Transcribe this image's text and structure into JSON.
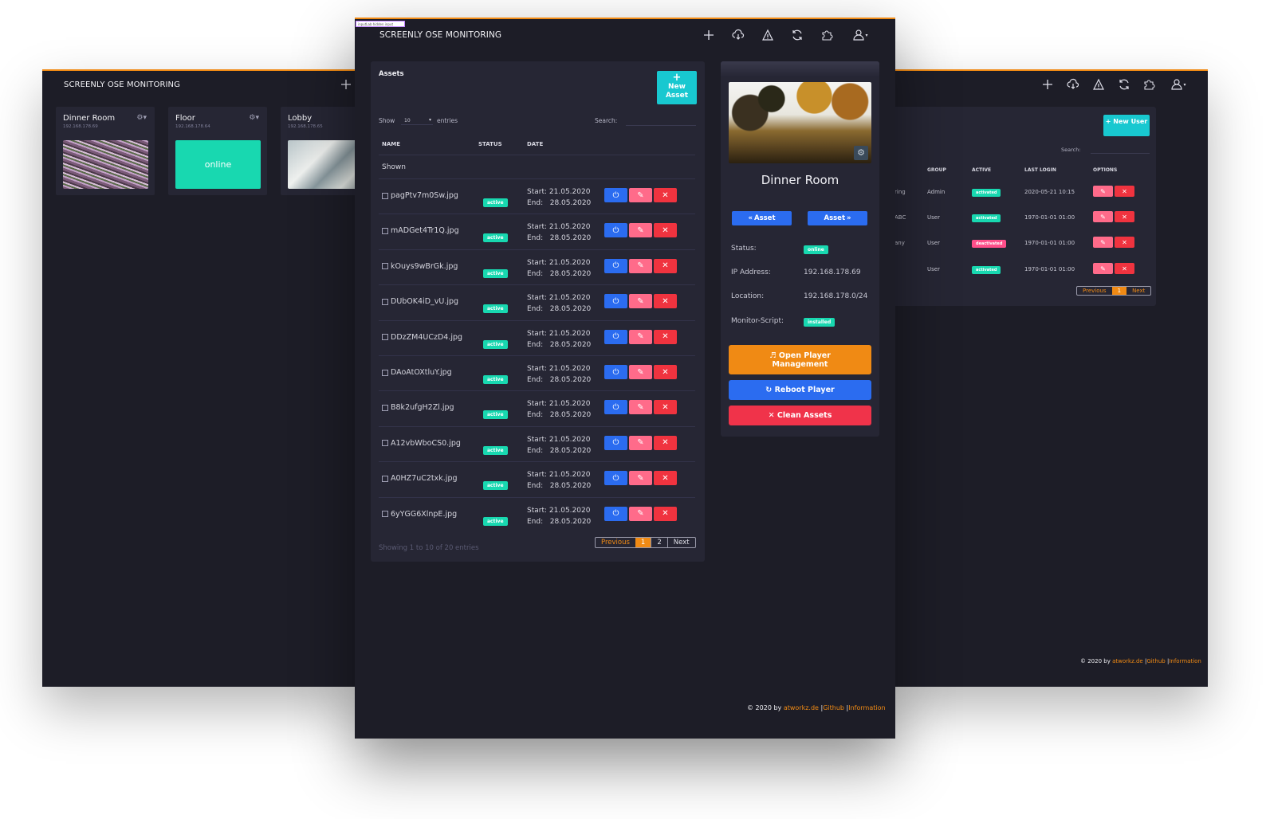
{
  "app": {
    "title": "SCREENLY OSE MONITORING",
    "hidden_input_tag": "inputLab hidden input"
  },
  "colors": {
    "accent": "#f08a14",
    "background": "#1d1d27",
    "panel": "#262634",
    "teal": "#18d8b0",
    "blue": "#2b6cf0",
    "pink": "#ff6b8a",
    "red": "#f0333f"
  },
  "topnav_icons": [
    "plus-icon",
    "cloud-download-icon",
    "upload-warning-icon",
    "refresh-icon",
    "puzzle-icon",
    "user-icon"
  ],
  "players": [
    {
      "name": "Dinner Room",
      "ip": "192.168.178.69",
      "status": ""
    },
    {
      "name": "Floor",
      "ip": "192.168.178.64",
      "status": "online"
    },
    {
      "name": "Lobby",
      "ip": "192.168.178.65",
      "status": ""
    }
  ],
  "assets": {
    "title": "Assets",
    "new_button": "New Asset",
    "show_label": "Show",
    "entries_value": "10",
    "entries_label": "entries",
    "search_label": "Search:",
    "columns": [
      "NAME",
      "STATUS",
      "DATE"
    ],
    "shown_label": "Shown",
    "start_prefix": "Start:",
    "end_prefix": "End:",
    "rows": [
      {
        "name": "pagPtv7m0Sw.jpg",
        "status": "active",
        "start": "21.05.2020",
        "end": "28.05.2020"
      },
      {
        "name": "mADGet4Tr1Q.jpg",
        "status": "active",
        "start": "21.05.2020",
        "end": "28.05.2020"
      },
      {
        "name": "kOuys9wBrGk.jpg",
        "status": "active",
        "start": "21.05.2020",
        "end": "28.05.2020"
      },
      {
        "name": "DUbOK4iD_vU.jpg",
        "status": "active",
        "start": "21.05.2020",
        "end": "28.05.2020"
      },
      {
        "name": "DDzZM4UCzD4.jpg",
        "status": "active",
        "start": "21.05.2020",
        "end": "28.05.2020"
      },
      {
        "name": "DAoAtOXtluY.jpg",
        "status": "active",
        "start": "21.05.2020",
        "end": "28.05.2020"
      },
      {
        "name": "B8k2ufgH2Zl.jpg",
        "status": "active",
        "start": "21.05.2020",
        "end": "28.05.2020"
      },
      {
        "name": "A12vbWboCS0.jpg",
        "status": "active",
        "start": "21.05.2020",
        "end": "28.05.2020"
      },
      {
        "name": "A0HZ7uC2txk.jpg",
        "status": "active",
        "start": "21.05.2020",
        "end": "28.05.2020"
      },
      {
        "name": "6yYGG6XlnpE.jpg",
        "status": "active",
        "start": "21.05.2020",
        "end": "28.05.2020"
      }
    ],
    "info": "Showing 1 to 10 of 20 entries",
    "pager": {
      "prev": "Previous",
      "pages": [
        "1",
        "2"
      ],
      "current": "1",
      "next": "Next"
    }
  },
  "player_detail": {
    "name": "Dinner Room",
    "prev_asset": "Asset",
    "next_asset": "Asset",
    "status_label": "Status:",
    "status_value": "online",
    "ip_label": "IP Address:",
    "ip_value": "192.168.178.69",
    "location_label": "Location:",
    "location_value": "192.168.178.0/24",
    "script_label": "Monitor-Script:",
    "script_value": "installed",
    "open_mgmt": "Open Player Management",
    "reboot": "Reboot Player",
    "clean": "Clean Assets"
  },
  "users": {
    "new_button": "New User",
    "search_label": "Search:",
    "columns": [
      "GROUP",
      "ACTIVE",
      "LAST LOGIN",
      "OPTIONS"
    ],
    "rows": [
      {
        "name_fragment": "ring",
        "group": "Admin",
        "active": "activated",
        "last_login": "2020-05-21 10:15"
      },
      {
        "name_fragment": "ABC",
        "group": "User",
        "active": "activated",
        "last_login": "1970-01-01 01:00"
      },
      {
        "name_fragment": "any",
        "group": "User",
        "active": "deactivated",
        "last_login": "1970-01-01 01:00"
      },
      {
        "name_fragment": "",
        "group": "User",
        "active": "activated",
        "last_login": "1970-01-01 01:00"
      }
    ],
    "pager": {
      "prev": "Previous",
      "current": "1",
      "next": "Next"
    }
  },
  "footer": {
    "prefix": "© 2020 by",
    "company": "atworkz.de",
    "sep": "|",
    "github": "Github",
    "information": "Information"
  }
}
